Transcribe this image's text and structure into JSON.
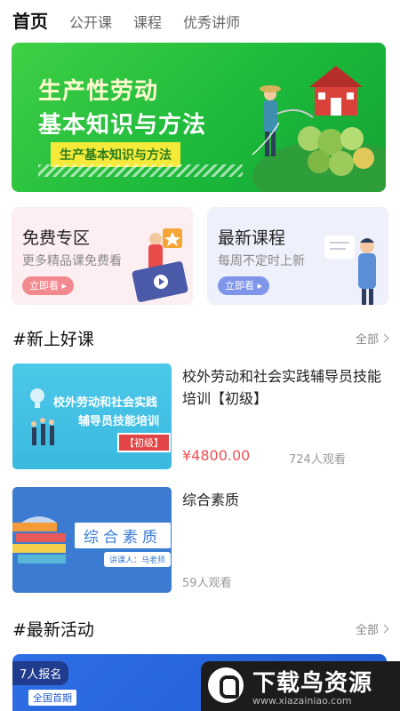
{
  "tabs": [
    {
      "label": "首页",
      "active": true
    },
    {
      "label": "公开课",
      "active": false
    },
    {
      "label": "课程",
      "active": false
    },
    {
      "label": "优秀讲师",
      "active": false
    }
  ],
  "banner": {
    "line1": "生产性劳动",
    "line2": "基本知识与方法",
    "tag": "生产基本知识与方法",
    "colors": {
      "bg": "#1bb83a",
      "tag_bg": "#f5ea3a"
    }
  },
  "promos": {
    "free": {
      "title": "免费专区",
      "subtitle": "更多精品课免费看",
      "button": "立即看 ▸"
    },
    "latest": {
      "title": "最新课程",
      "subtitle": "每周不定时上新",
      "button": "立即看 ▸"
    }
  },
  "section_new": {
    "title": "#新上好课",
    "more": "全部"
  },
  "courses": [
    {
      "title": "校外劳动和社会实践辅导员技能培训【初级】",
      "price": "¥4800.00",
      "views": "724人观看",
      "thumb": {
        "line1": "校外劳动和社会实践",
        "line2": "辅导员技能培训",
        "level": "【初级】"
      }
    },
    {
      "title": "综合素质",
      "views": "59人观看",
      "thumb": {
        "label": "综合素质",
        "teacher": "讲课人：马老师"
      }
    }
  ],
  "section_activity": {
    "title": "#最新活动",
    "more": "全部"
  },
  "activity": {
    "registered": "7人报名",
    "badge": "全国首期"
  },
  "watermark": {
    "name": "下载鸟资源",
    "url": "www.xiazainiao.com"
  }
}
